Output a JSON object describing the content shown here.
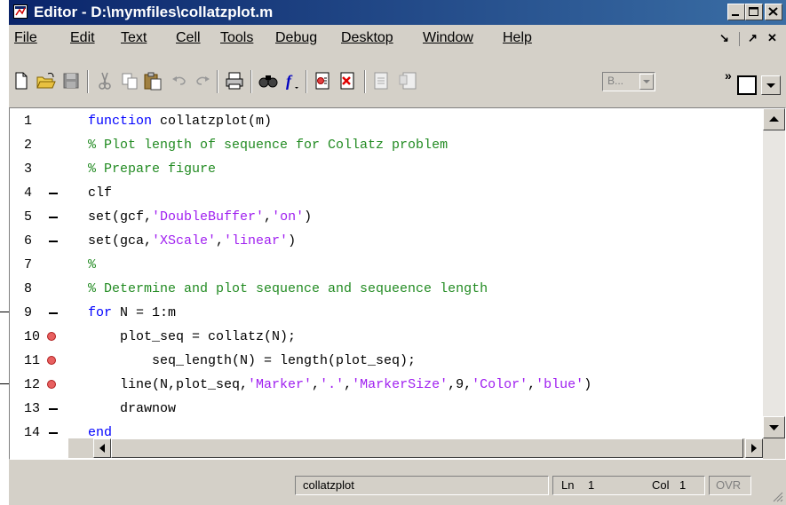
{
  "window": {
    "title": "Editor - D:\\mymfiles\\collatzplot.m",
    "controls": [
      "minimize",
      "maximize",
      "close"
    ]
  },
  "menubar": {
    "items": [
      {
        "label": "File"
      },
      {
        "label": "Edit"
      },
      {
        "label": "Text"
      },
      {
        "label": "Cell"
      },
      {
        "label": "Tools"
      },
      {
        "label": "Debug"
      },
      {
        "label": "Desktop"
      },
      {
        "label": "Window"
      },
      {
        "label": "Help"
      }
    ],
    "right_glyphs": [
      "↘",
      "↗",
      "✕"
    ]
  },
  "toolbar": {
    "icons": [
      "new-file-icon",
      "open-folder-icon",
      "save-icon",
      "cut-icon",
      "copy-icon",
      "paste-icon",
      "undo-icon",
      "redo-icon",
      "print-icon",
      "find-icon",
      "function-icon",
      "set-breakpoint-icon",
      "clear-breakpoint-icon",
      "step-icon",
      "step-in-icon"
    ],
    "stack_combo": "B...",
    "overflow": "»"
  },
  "editor": {
    "lines": [
      {
        "num": "1",
        "mark": "",
        "segments": [
          {
            "t": "kw",
            "v": "function"
          },
          {
            "t": "n",
            "v": " collatzplot(m)"
          }
        ]
      },
      {
        "num": "2",
        "mark": "",
        "segments": [
          {
            "t": "cm",
            "v": "% Plot length of sequence for Collatz problem"
          }
        ]
      },
      {
        "num": "3",
        "mark": "",
        "segments": [
          {
            "t": "cm",
            "v": "% Prepare figure"
          }
        ]
      },
      {
        "num": "4",
        "mark": "-",
        "segments": [
          {
            "t": "n",
            "v": "clf"
          }
        ]
      },
      {
        "num": "5",
        "mark": "-",
        "segments": [
          {
            "t": "n",
            "v": "set(gcf,"
          },
          {
            "t": "st",
            "v": "'DoubleBuffer'"
          },
          {
            "t": "n",
            "v": ","
          },
          {
            "t": "st",
            "v": "'on'"
          },
          {
            "t": "n",
            "v": ")"
          }
        ]
      },
      {
        "num": "6",
        "mark": "-",
        "segments": [
          {
            "t": "n",
            "v": "set(gca,"
          },
          {
            "t": "st",
            "v": "'XScale'"
          },
          {
            "t": "n",
            "v": ","
          },
          {
            "t": "st",
            "v": "'linear'"
          },
          {
            "t": "n",
            "v": ")"
          }
        ]
      },
      {
        "num": "7",
        "mark": "",
        "segments": [
          {
            "t": "cm",
            "v": "%"
          }
        ]
      },
      {
        "num": "8",
        "mark": "",
        "segments": [
          {
            "t": "cm",
            "v": "% Determine and plot sequence and sequeence length"
          }
        ]
      },
      {
        "num": "9",
        "mark": "-",
        "segments": [
          {
            "t": "kw",
            "v": "for"
          },
          {
            "t": "n",
            "v": " N = 1:m"
          }
        ]
      },
      {
        "num": "10",
        "mark": "bp",
        "segments": [
          {
            "t": "n",
            "v": "    plot_seq = collatz(N);"
          }
        ]
      },
      {
        "num": "11",
        "mark": "bp",
        "segments": [
          {
            "t": "n",
            "v": "        seq_length(N) = length(plot_seq);"
          }
        ]
      },
      {
        "num": "12",
        "mark": "bp",
        "segments": [
          {
            "t": "n",
            "v": "    line(N,plot_seq,"
          },
          {
            "t": "st",
            "v": "'Marker'"
          },
          {
            "t": "n",
            "v": ","
          },
          {
            "t": "st",
            "v": "'.'"
          },
          {
            "t": "n",
            "v": ","
          },
          {
            "t": "st",
            "v": "'MarkerSize'"
          },
          {
            "t": "n",
            "v": ",9,"
          },
          {
            "t": "st",
            "v": "'Color'"
          },
          {
            "t": "n",
            "v": ","
          },
          {
            "t": "st",
            "v": "'blue'"
          },
          {
            "t": "n",
            "v": ")"
          }
        ]
      },
      {
        "num": "13",
        "mark": "-",
        "segments": [
          {
            "t": "n",
            "v": "    drawnow"
          }
        ]
      },
      {
        "num": "14",
        "mark": "-",
        "segments": [
          {
            "t": "kw",
            "v": "end"
          }
        ]
      }
    ]
  },
  "statusbar": {
    "function_name": "collatzplot",
    "ln_label": "Ln",
    "ln_value": "1",
    "col_label": "Col",
    "col_value": "1",
    "ovr": "OVR"
  },
  "colors": {
    "keyword": "#0000ff",
    "comment": "#228b22",
    "string": "#a020f0",
    "breakpoint": "#e86060",
    "titlebar_start": "#0a246a",
    "titlebar_end": "#3a6ea5"
  }
}
